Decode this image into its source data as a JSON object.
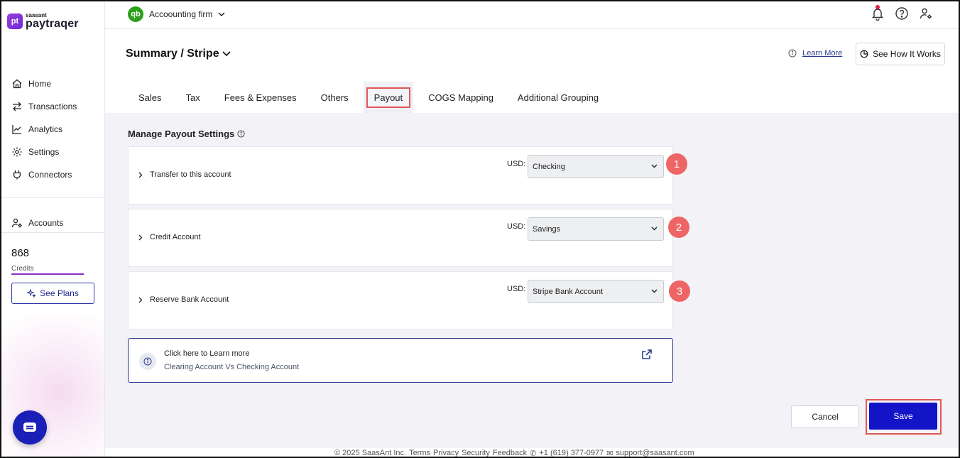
{
  "brand": {
    "small": "saasant",
    "name": "paytraqer",
    "mark": "pt"
  },
  "sidebar": {
    "items": [
      {
        "label": "Home",
        "icon": "home-icon"
      },
      {
        "label": "Transactions",
        "icon": "arrows-swap-icon"
      },
      {
        "label": "Analytics",
        "icon": "line-chart-icon"
      },
      {
        "label": "Settings",
        "icon": "gear-icon"
      },
      {
        "label": "Connectors",
        "icon": "plug-icon"
      }
    ],
    "accounts_label": "Accounts",
    "credits_value": "868",
    "credits_label": "Credits",
    "see_plans_label": "See Plans"
  },
  "topbar": {
    "firm_name": "Accoounting firm",
    "qb_mark": "qb"
  },
  "header": {
    "title": "Summary / Stripe",
    "learn_more": "Learn More",
    "see_how": "See How It Works"
  },
  "tabs": [
    "Sales",
    "Tax",
    "Fees & Expenses",
    "Others",
    "Payout",
    "COGS Mapping",
    "Additional Grouping"
  ],
  "active_tab": "Payout",
  "main": {
    "section_title": "Manage Payout Settings",
    "currency_label": "USD:",
    "rows": [
      {
        "label": "Transfer to this account",
        "selected": "Checking",
        "badge": "1"
      },
      {
        "label": "Credit Account",
        "selected": "Savings",
        "badge": "2"
      },
      {
        "label": "Reserve Bank Account",
        "selected": "Stripe Bank Account",
        "badge": "3"
      }
    ],
    "info_title": "Click here to Learn more",
    "info_sub": "Clearing Account Vs Checking Account",
    "cancel": "Cancel",
    "save": "Save"
  },
  "footer": {
    "copyright": "© 2025 SaasAnt Inc.",
    "links": [
      "Terms",
      "Privacy",
      "Security",
      "Feedback"
    ],
    "phone": "+1 (619) 377-0977",
    "email": "support@saasant.com"
  },
  "colors": {
    "brand_purple": "#8b2fc9",
    "primary": "#1313c7",
    "badge": "#ee6565",
    "highlight": "#e05757"
  }
}
